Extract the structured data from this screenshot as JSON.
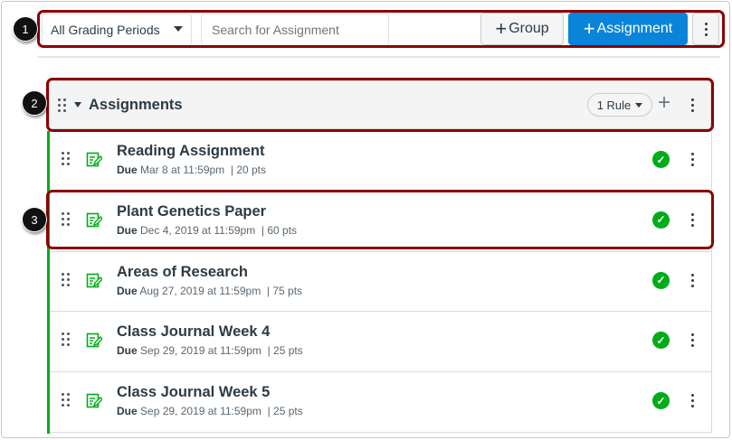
{
  "toolbar": {
    "grading_period": "All Grading Periods",
    "search_placeholder": "Search for Assignment",
    "group_label": "Group",
    "assignment_label": "Assignment"
  },
  "group": {
    "title": "Assignments",
    "rule_label": "1 Rule"
  },
  "callouts": [
    "1",
    "2",
    "3"
  ],
  "assignments": [
    {
      "title": "Reading Assignment",
      "due_label": "Due",
      "due": "Mar 8 at 11:59pm",
      "points": "20 pts"
    },
    {
      "title": "Plant Genetics Paper",
      "due_label": "Due",
      "due": "Dec 4, 2019 at 11:59pm",
      "points": "60 pts"
    },
    {
      "title": "Areas of Research",
      "due_label": "Due",
      "due": "Aug 27, 2019 at 11:59pm",
      "points": "75 pts"
    },
    {
      "title": "Class Journal Week 4",
      "due_label": "Due",
      "due": "Sep 29, 2019 at 11:59pm",
      "points": "25 pts"
    },
    {
      "title": "Class Journal Week 5",
      "due_label": "Due",
      "due": "Sep 29, 2019 at 11:59pm",
      "points": "25 pts"
    }
  ],
  "colors": {
    "accent": "#0a84d9",
    "published": "#00ac18",
    "callout_box": "#8b0000"
  }
}
